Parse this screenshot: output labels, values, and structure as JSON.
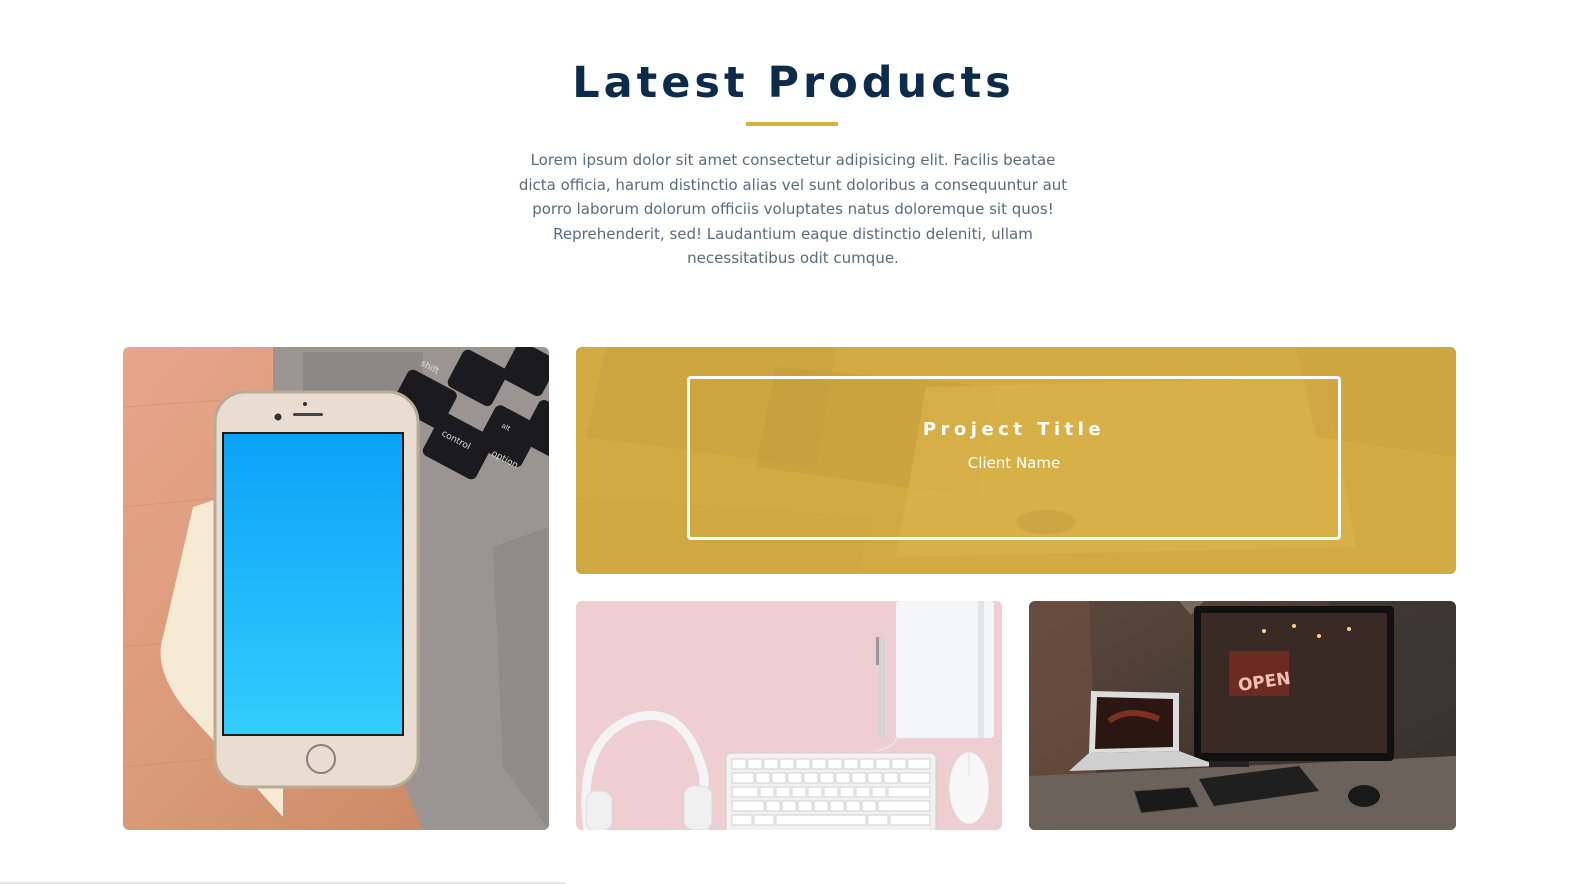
{
  "section": {
    "title": "Latest Products",
    "intro": "Lorem ipsum dolor sit amet consectetur adipisicing elit. Facilis beatae dicta officia, harum distinctio alias vel sunt doloribus a consequuntur aut porro laborum dolorum officiis voluptates natus doloremque sit quos! Reprehenderit, sed! Laudantium eaque distinctio deleniti, ullam necessitatibus odit cumque.",
    "accent_color": "#d9b13f",
    "title_color": "#0d2b4a"
  },
  "products": {
    "featured": {
      "project_title": "Project Title",
      "client_name": "Client Name",
      "overlay_color": "#e0b84a"
    },
    "photos": {
      "phone_keys": [
        "shift",
        "control",
        "alt",
        "option"
      ],
      "open_sign": "OPEN"
    }
  }
}
